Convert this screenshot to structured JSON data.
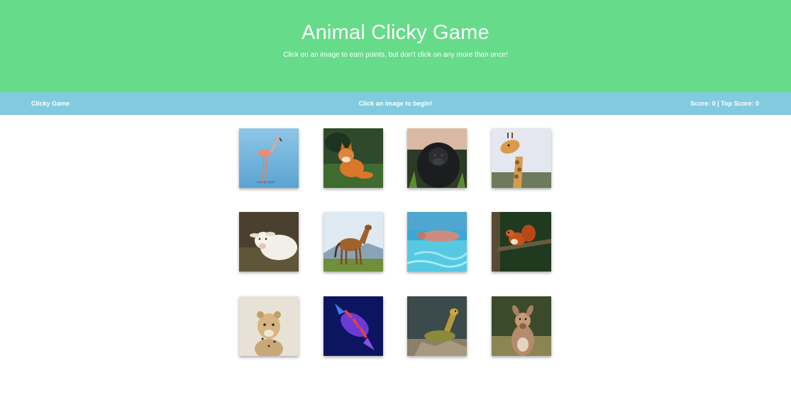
{
  "header": {
    "title": "Animal Clicky Game",
    "subtitle": "Click on an image to earn points, but don't click on any more than once!"
  },
  "navbar": {
    "brand": "Clicky Game",
    "message": "Click an image to begin!",
    "score_text": "Score: 0 | Top Score: 0"
  },
  "colors": {
    "header_bg": "#66db8a",
    "navbar_bg": "#82cadf"
  },
  "cards": [
    {
      "animal": "flamingo"
    },
    {
      "animal": "fox"
    },
    {
      "animal": "gorilla"
    },
    {
      "animal": "giraffe"
    },
    {
      "animal": "calf"
    },
    {
      "animal": "horse"
    },
    {
      "animal": "pig"
    },
    {
      "animal": "squirrel"
    },
    {
      "animal": "cheetah"
    },
    {
      "animal": "fish"
    },
    {
      "animal": "iguana"
    },
    {
      "animal": "kangaroo"
    }
  ]
}
